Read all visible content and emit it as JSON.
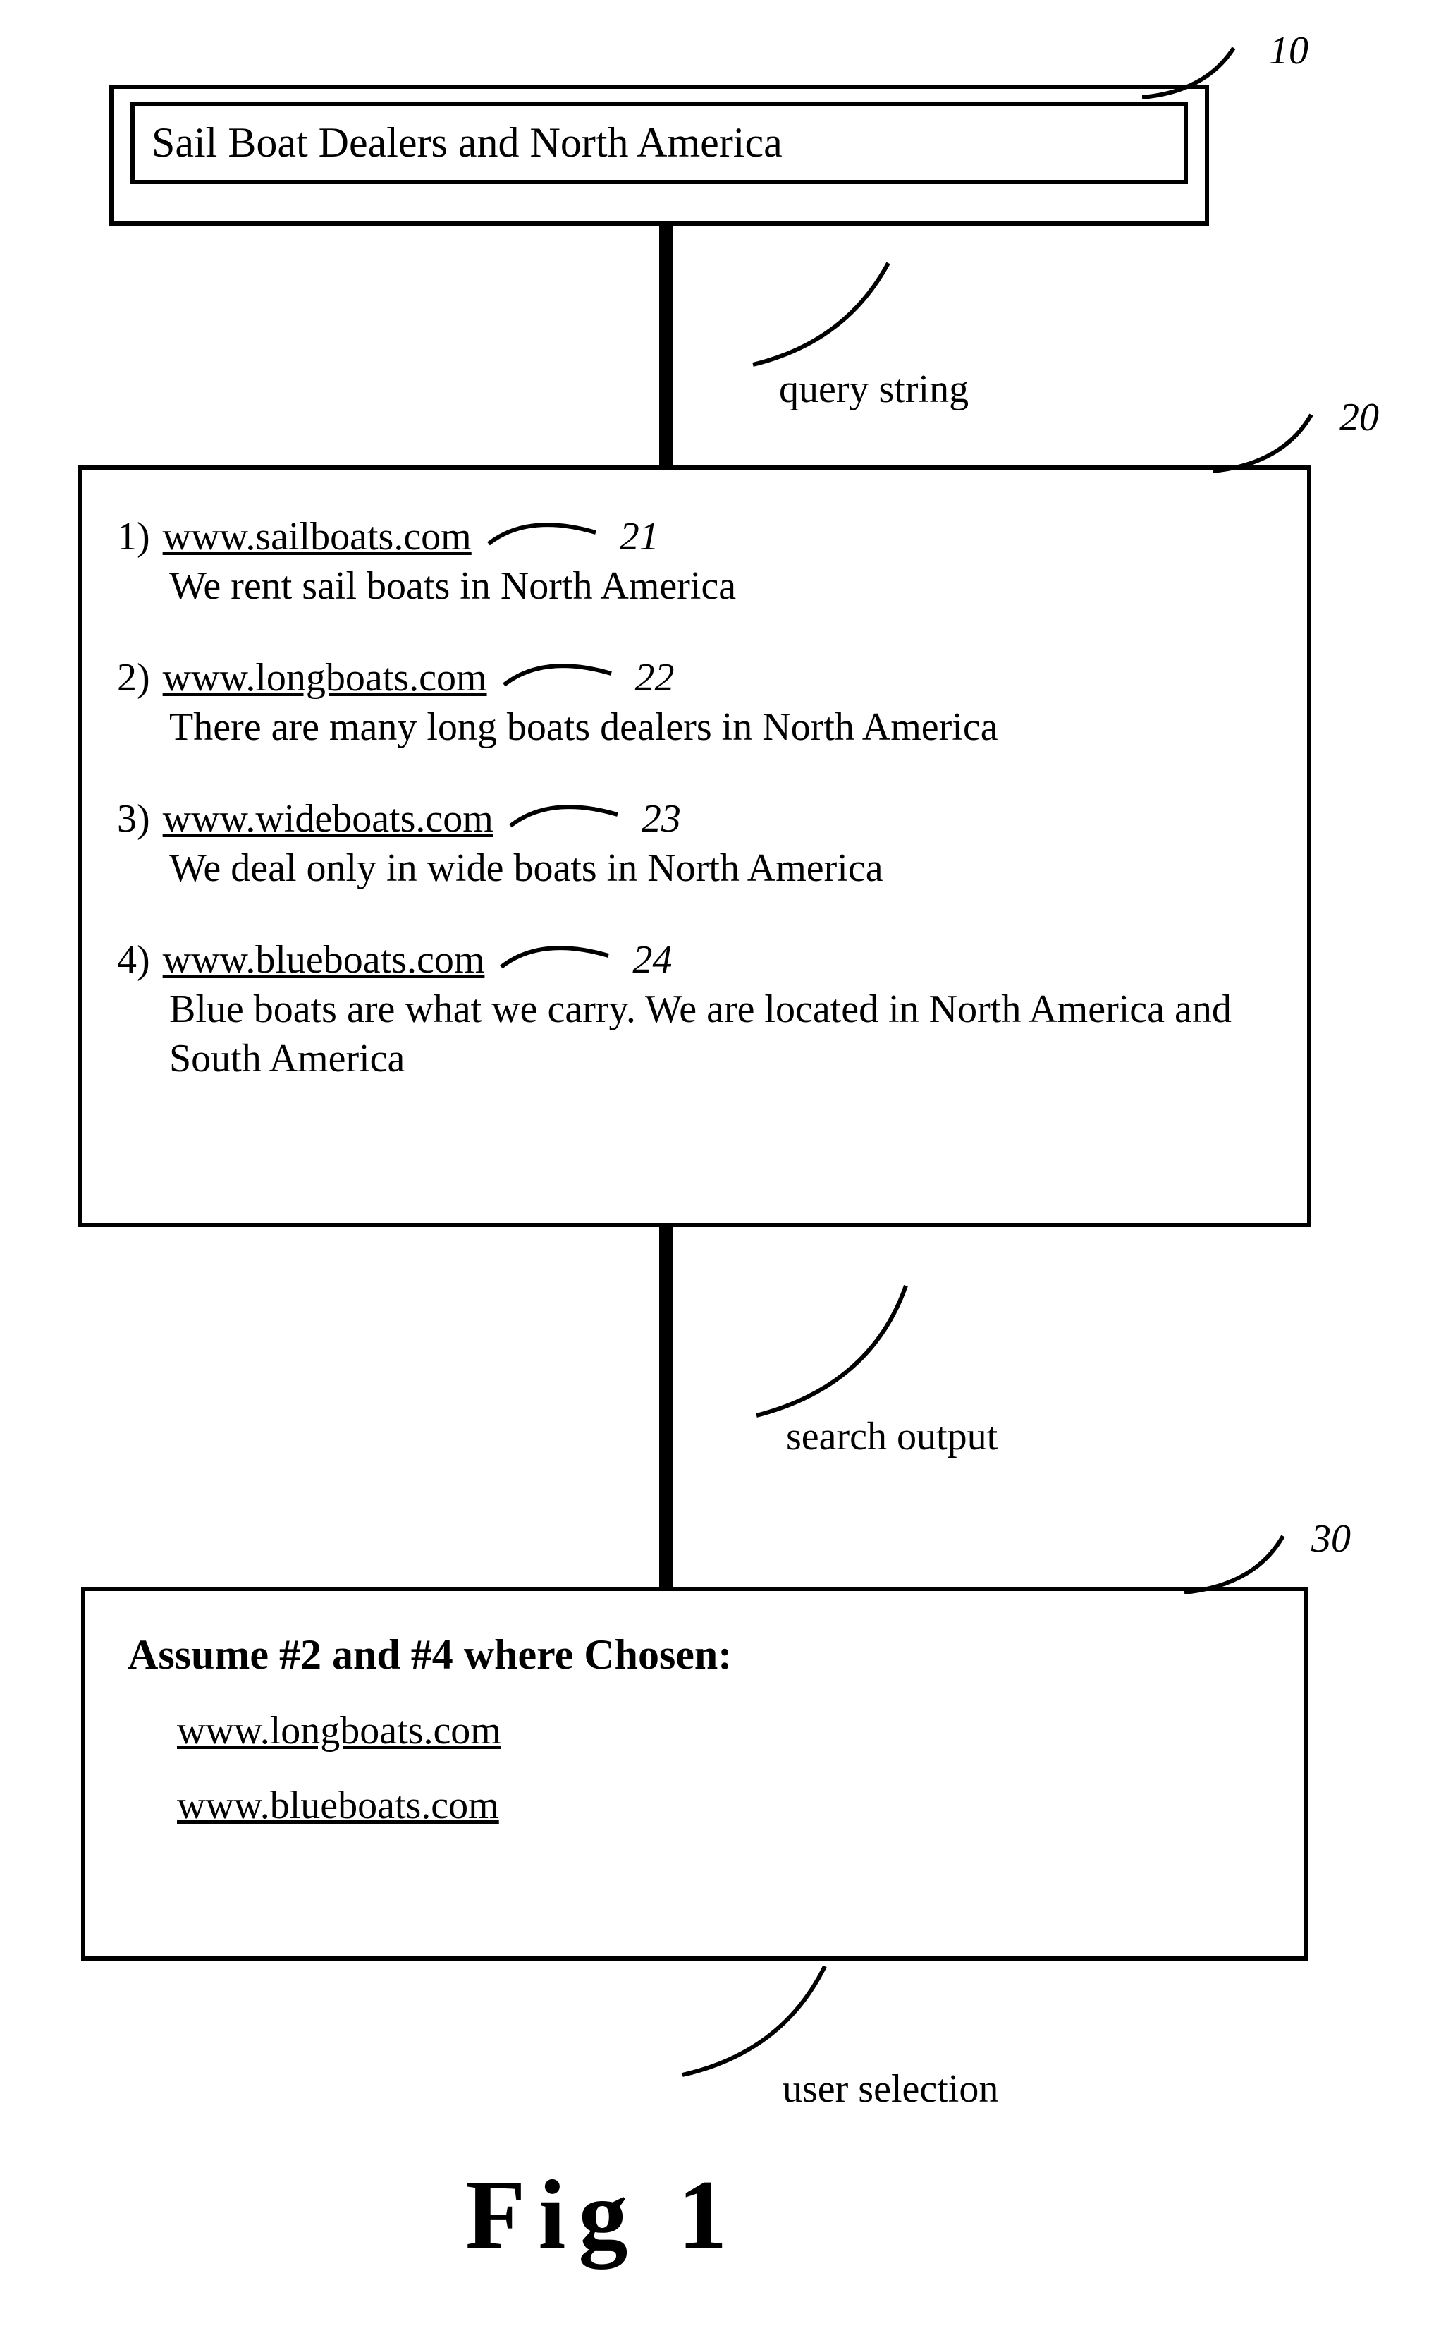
{
  "query": {
    "text": "Sail Boat Dealers and North America",
    "refnum": "10",
    "connector_label": "query string"
  },
  "results_panel": {
    "refnum": "20",
    "connector_label": "search output",
    "items": [
      {
        "n": "1)",
        "url": "www.sailboats.com",
        "ref": "21",
        "desc": "We rent sail boats in North America"
      },
      {
        "n": "2)",
        "url": "www.longboats.com",
        "ref": "22",
        "desc": "There are many long boats dealers in North America"
      },
      {
        "n": "3)",
        "url": "www.wideboats.com",
        "ref": "23",
        "desc": "We deal only in wide boats in North America"
      },
      {
        "n": "4)",
        "url": "www.blueboats.com",
        "ref": "24",
        "desc": "Blue boats are what we carry. We are located in North America and South America"
      }
    ]
  },
  "selection_panel": {
    "refnum": "30",
    "connector_label": "user selection",
    "title": "Assume #2 and #4 where Chosen:",
    "chosen": [
      "www.longboats.com",
      "www.blueboats.com"
    ]
  },
  "figure_label": "Fig  1"
}
